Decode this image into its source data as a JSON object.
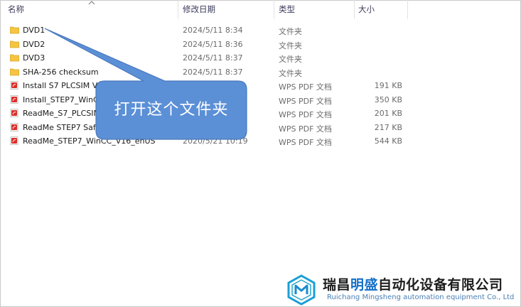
{
  "columns": {
    "name": "名称",
    "date": "修改日期",
    "type": "类型",
    "size": "大小"
  },
  "files": [
    {
      "name": "DVD1",
      "date": "2024/5/11 8:34",
      "type": "文件夹",
      "size": "",
      "icon": "folder-icon"
    },
    {
      "name": "DVD2",
      "date": "2024/5/11 8:36",
      "type": "文件夹",
      "size": "",
      "icon": "folder-icon"
    },
    {
      "name": "DVD3",
      "date": "2024/5/11 8:37",
      "type": "文件夹",
      "size": "",
      "icon": "folder-icon"
    },
    {
      "name": "SHA-256 checksum",
      "date": "2024/5/11 8:37",
      "type": "文件夹",
      "size": "",
      "icon": "folder-icon"
    },
    {
      "name": "Install S7 PLCSIM V",
      "date": "",
      "type": "WPS PDF 文档",
      "size": "191 KB",
      "icon": "pdf-icon"
    },
    {
      "name": "Install_STEP7_WinC",
      "date": "",
      "type": "WPS PDF 文档",
      "size": "350 KB",
      "icon": "pdf-icon"
    },
    {
      "name": "ReadMe_S7_PLCSIM",
      "date": "",
      "type": "WPS PDF 文档",
      "size": "201 KB",
      "icon": "pdf-icon"
    },
    {
      "name": "ReadMe STEP7 Saf",
      "date": "",
      "type": "WPS PDF 文档",
      "size": "217 KB",
      "icon": "pdf-icon"
    },
    {
      "name": "ReadMe_STEP7_WinCC_V16_enUS",
      "date": "2020/5/21 10:19",
      "type": "WPS PDF 文档",
      "size": "544 KB",
      "icon": "pdf-icon"
    }
  ],
  "callout": {
    "text": "打开这个文件夹",
    "color": "#5b8fd6"
  },
  "logo": {
    "cn_prefix": "瑞昌",
    "cn_highlight": "明盛",
    "cn_suffix": "自动化设备有限公司",
    "en": "Ruichang Mingsheng automation equipment Co., Ltd"
  },
  "colors": {
    "folder": "#f5c542",
    "pdf": "#d9302c",
    "accent": "#1570c9"
  }
}
